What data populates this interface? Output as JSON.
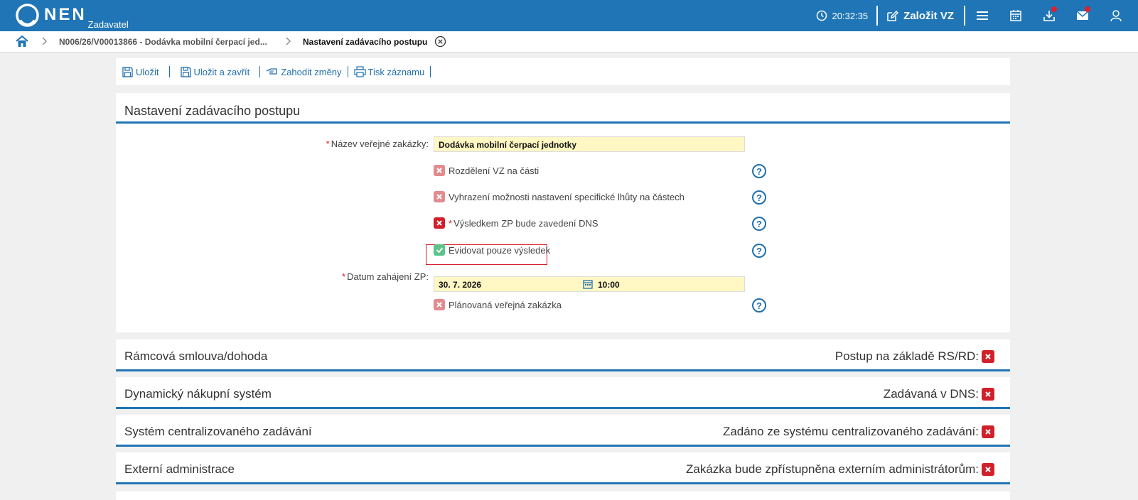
{
  "app": {
    "logo_text": "NEN",
    "logo_sub": "Zadavatel",
    "time": "20:32:35",
    "create_label": "Založit VZ"
  },
  "breadcrumb": {
    "item1": "N006/26/V00013866 - Dodávka mobilní čerpací jed...",
    "item2": "Nastavení zadávacího postupu"
  },
  "toolbar": {
    "save": "Uložit",
    "save_close": "Uložit a zavřít",
    "discard": "Zahodit změny",
    "print": "Tisk záznamu"
  },
  "form": {
    "title": "Nastavení zadávacího postupu",
    "name_label": "Název veřejné zakázky:",
    "name_value": "Dodávka mobilní čerpací jednotky",
    "split_label": "Rozdělení VZ na části",
    "specific_label": "Vyhrazení možnosti nastavení specifické lhůty na částech",
    "dns_label": "Výsledkem ZP bude zavedení DNS",
    "only_result_label": "Evidovat pouze výsledek",
    "date_label": "Datum zahájení ZP:",
    "date_value": "30. 7. 2026",
    "time_value": "10:00",
    "planned_label": "Plánovaná veřejná zakázka",
    "help_glyph": "?",
    "required_mark": "*"
  },
  "sections": [
    {
      "title": "Rámcová smlouva/dohoda",
      "right": "Postup na základě RS/RD:"
    },
    {
      "title": "Dynamický nákupní systém",
      "right": "Zadávaná v DNS:"
    },
    {
      "title": "Systém centralizovaného zadávání",
      "right": "Zadáno ze systému centralizovaného zadávání:"
    },
    {
      "title": "Externí administrace",
      "right": "Zakázka bude zpřístupněna externím administrátorům:"
    }
  ],
  "colors": {
    "brand": "#1f75b5",
    "required": "#d0202a",
    "input_bg": "#fff7c4",
    "checked": "#5cc48a"
  }
}
